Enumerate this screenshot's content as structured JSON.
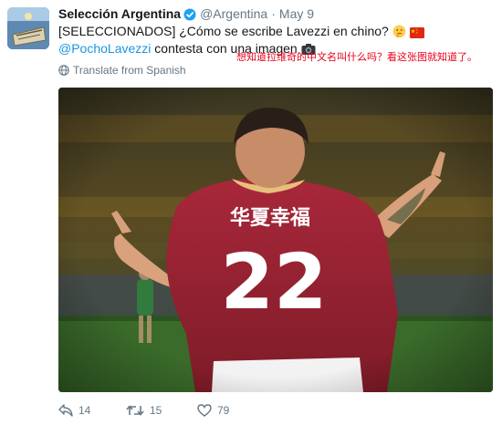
{
  "tweet": {
    "author": {
      "display_name": "Selección Argentina",
      "handle": "@Argentina",
      "verified": true
    },
    "separator": "·",
    "timestamp": "May 9",
    "text": {
      "line1": "[SELECCIONADOS] ¿Cómo se escribe Lavezzi en chino?",
      "line2_mention": "@PochoLavezzi",
      "line2_rest": " contesta con una imagen"
    },
    "annotation": "想知道拉维奇的中文名叫什么吗？看这张图就知道了。",
    "translate_label": "Translate from Spanish",
    "media": {
      "jersey_text": "华夏幸福",
      "jersey_number": "22"
    },
    "actions": {
      "reply_count": "14",
      "retweet_count": "15",
      "like_count": "79"
    },
    "colors": {
      "link": "#1b95e0",
      "muted": "#657786",
      "annotation": "#e8001c",
      "jersey": "#9c1f2b"
    },
    "icons": {
      "verified": "verified-badge-icon",
      "thinking": "thinking-face-emoji",
      "flag": "china-flag-emoji",
      "camera": "camera-emoji",
      "globe": "globe-icon",
      "reply": "reply-icon",
      "retweet": "retweet-icon",
      "like": "heart-icon"
    }
  }
}
